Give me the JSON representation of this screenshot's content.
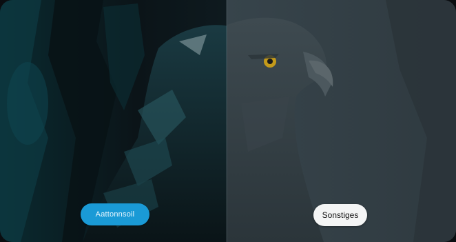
{
  "comparison": {
    "left_label": "Aattonnsoil",
    "right_label": "Sonstiges"
  },
  "image": {
    "subject-icon": "eagle-icon",
    "accent_left": "#1a9ad6",
    "accent_right": "#f4f5f5"
  }
}
